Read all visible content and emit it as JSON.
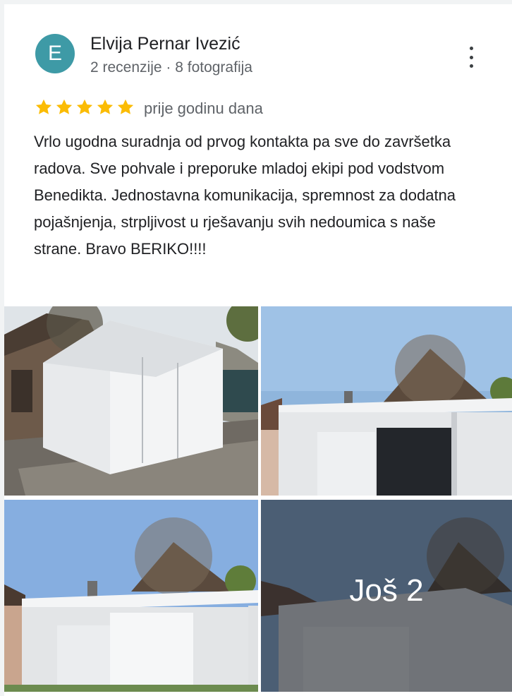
{
  "reviewer": {
    "initial": "E",
    "avatar_color": "#3e9aa6",
    "name": "Elvija Pernar Ivezić",
    "meta": "2 recenzije · 8 fotografija"
  },
  "review": {
    "rating": 5,
    "star_color": "#fbbc04",
    "time": "prije godinu dana",
    "text": "Vrlo ugodna suradnja od prvog kontakta pa sve do završetka radova. Sve pohvale i preporuke mladoj ekipi pod vodstvom Benedikta. Jednostavna komunikacija, spremnost za dodatna pojašnjenja, strpljivost u rješavanju svih nedoumica s naše strane. Bravo BERIKO!!!!"
  },
  "photos": {
    "more_label": "Još 2"
  },
  "icons": [
    "more-vert-icon",
    "star-icon"
  ]
}
